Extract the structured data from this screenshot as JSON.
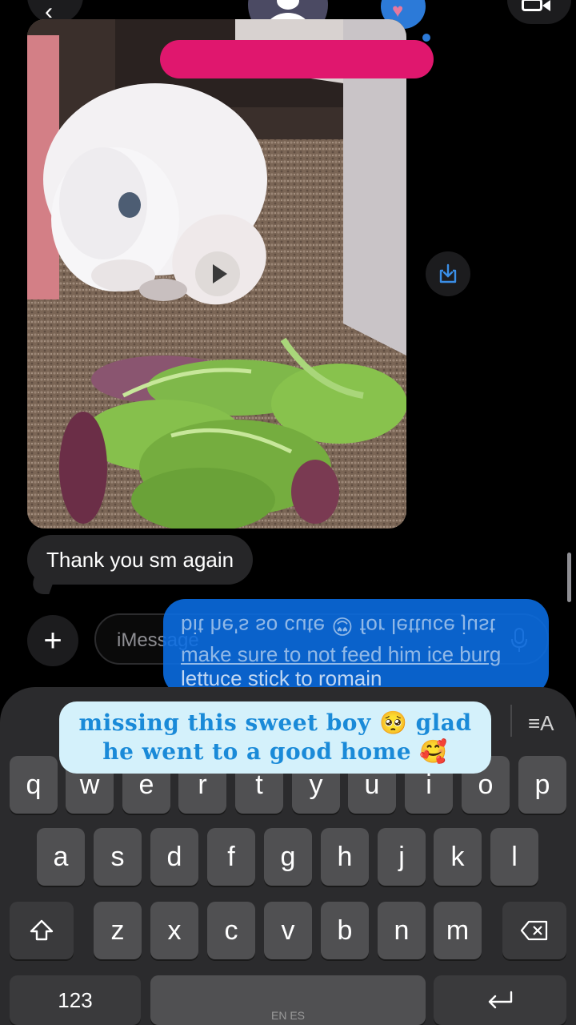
{
  "header": {
    "back_icon": "chevron-left-icon",
    "avatar_icon": "person-icon",
    "heart_icon": "heart-icon",
    "video_icon": "video-camera-icon",
    "redaction_color": "#e0176e"
  },
  "conversation": {
    "video_message": {
      "description_icon": "play-icon",
      "save_icon": "download-icon"
    },
    "received_message": "Thank you sm again",
    "sent_message": {
      "line1": "bit he's so cute 😍 for lettuce just",
      "line2": "make sure to not feed him ice burg",
      "line3": "lettuce stick to romain"
    }
  },
  "composer": {
    "plus_label": "+",
    "placeholder": "iMessage",
    "mic_icon": "microphone-icon"
  },
  "keyboard": {
    "translate_icon": "≡A",
    "row1": [
      "q",
      "w",
      "e",
      "r",
      "t",
      "y",
      "u",
      "i",
      "o",
      "p"
    ],
    "row2": [
      "a",
      "s",
      "d",
      "f",
      "g",
      "h",
      "j",
      "k",
      "l"
    ],
    "row3": [
      "z",
      "x",
      "c",
      "v",
      "b",
      "n",
      "m"
    ],
    "shift_icon": "shift-icon",
    "delete_icon": "delete-icon",
    "numbers_label": "123",
    "space_label": "EN ES",
    "return_icon": "return-icon"
  },
  "caption": {
    "line1": "missing this sweet boy 🥺 glad",
    "line2": "he went to a good home 🥰"
  },
  "colors": {
    "sent_bubble": "#0a6ee6",
    "received_bubble": "#262628",
    "caption_bg": "#d4f1fb",
    "caption_text": "#1a8ad8"
  }
}
